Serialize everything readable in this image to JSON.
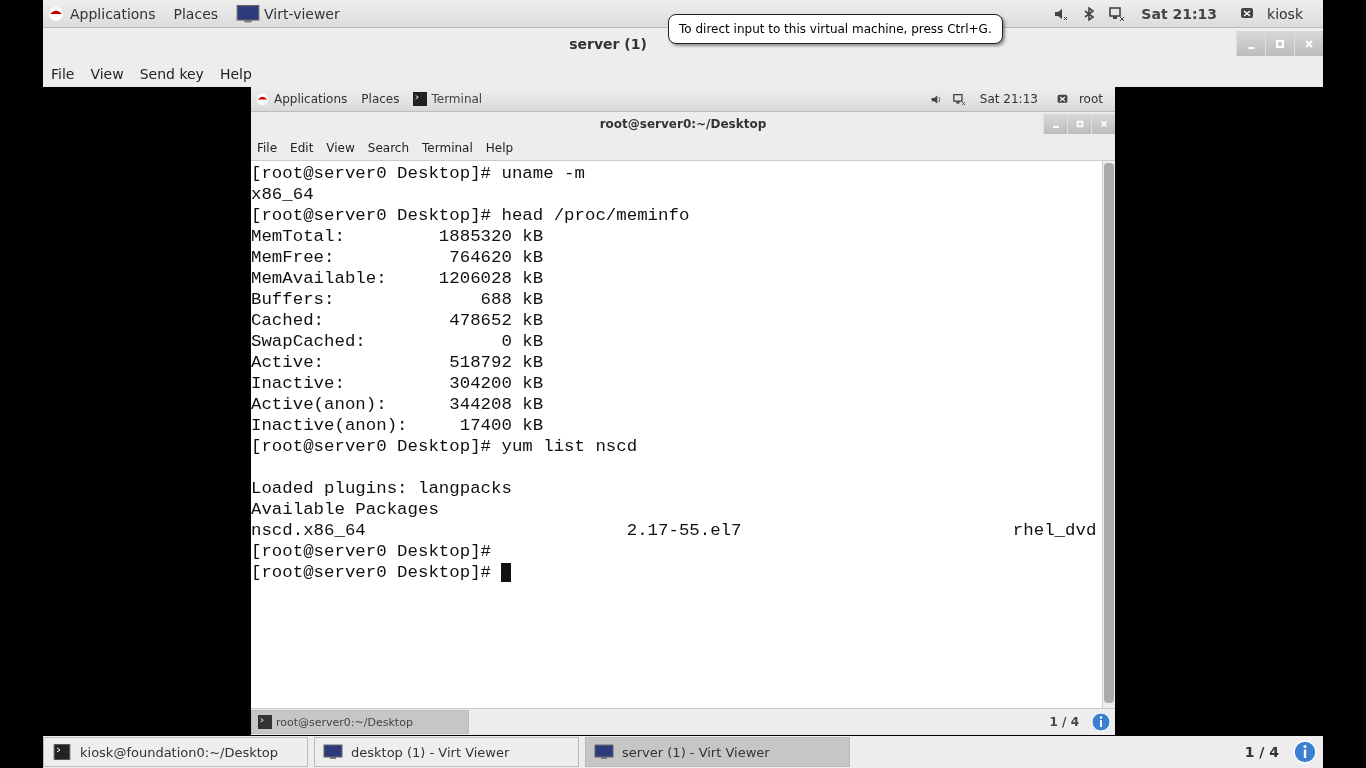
{
  "host_panel": {
    "menus": [
      "Applications",
      "Places"
    ],
    "app": "Virt-viewer",
    "clock": "Sat 21:13",
    "user": "kiosk"
  },
  "tooltip": "To direct input to this virtual machine, press Ctrl+G.",
  "window": {
    "title": "server (1)",
    "menu": [
      "File",
      "View",
      "Send key",
      "Help"
    ]
  },
  "guest": {
    "panel": {
      "menus": [
        "Applications",
        "Places"
      ],
      "app": "Terminal",
      "clock": "Sat 21:13",
      "user": "root"
    },
    "terminal": {
      "title": "root@server0:~/Desktop",
      "menu": [
        "File",
        "Edit",
        "View",
        "Search",
        "Terminal",
        "Help"
      ],
      "lines": [
        "[root@server0 Desktop]# uname -m",
        "x86_64",
        "[root@server0 Desktop]# head /proc/meminfo",
        "MemTotal:         1885320 kB",
        "MemFree:           764620 kB",
        "MemAvailable:     1206028 kB",
        "Buffers:              688 kB",
        "Cached:            478652 kB",
        "SwapCached:             0 kB",
        "Active:            518792 kB",
        "Inactive:          304200 kB",
        "Active(anon):      344208 kB",
        "Inactive(anon):     17400 kB",
        "[root@server0 Desktop]# yum list nscd",
        {
          "text": "Loaded plugins: langpacks",
          "blank_before": true
        },
        "Available Packages",
        "nscd.x86_64                         2.17-55.el7                          rhel_dvd",
        "[root@server0 Desktop]#",
        "[root@server0 Desktop]# "
      ]
    },
    "taskbar": {
      "tasks": [
        {
          "label": "root@server0:~/Desktop",
          "selected": true
        }
      ],
      "workspace": "1 / 4"
    }
  },
  "taskbar": {
    "tasks": [
      {
        "label": "kiosk@foundation0:~/Desktop",
        "kind": "terminal",
        "selected": false
      },
      {
        "label": "desktop (1) - Virt Viewer",
        "kind": "viewer",
        "selected": false
      },
      {
        "label": "server (1) - Virt Viewer",
        "kind": "viewer",
        "selected": true
      }
    ],
    "workspace": "1 / 4"
  }
}
